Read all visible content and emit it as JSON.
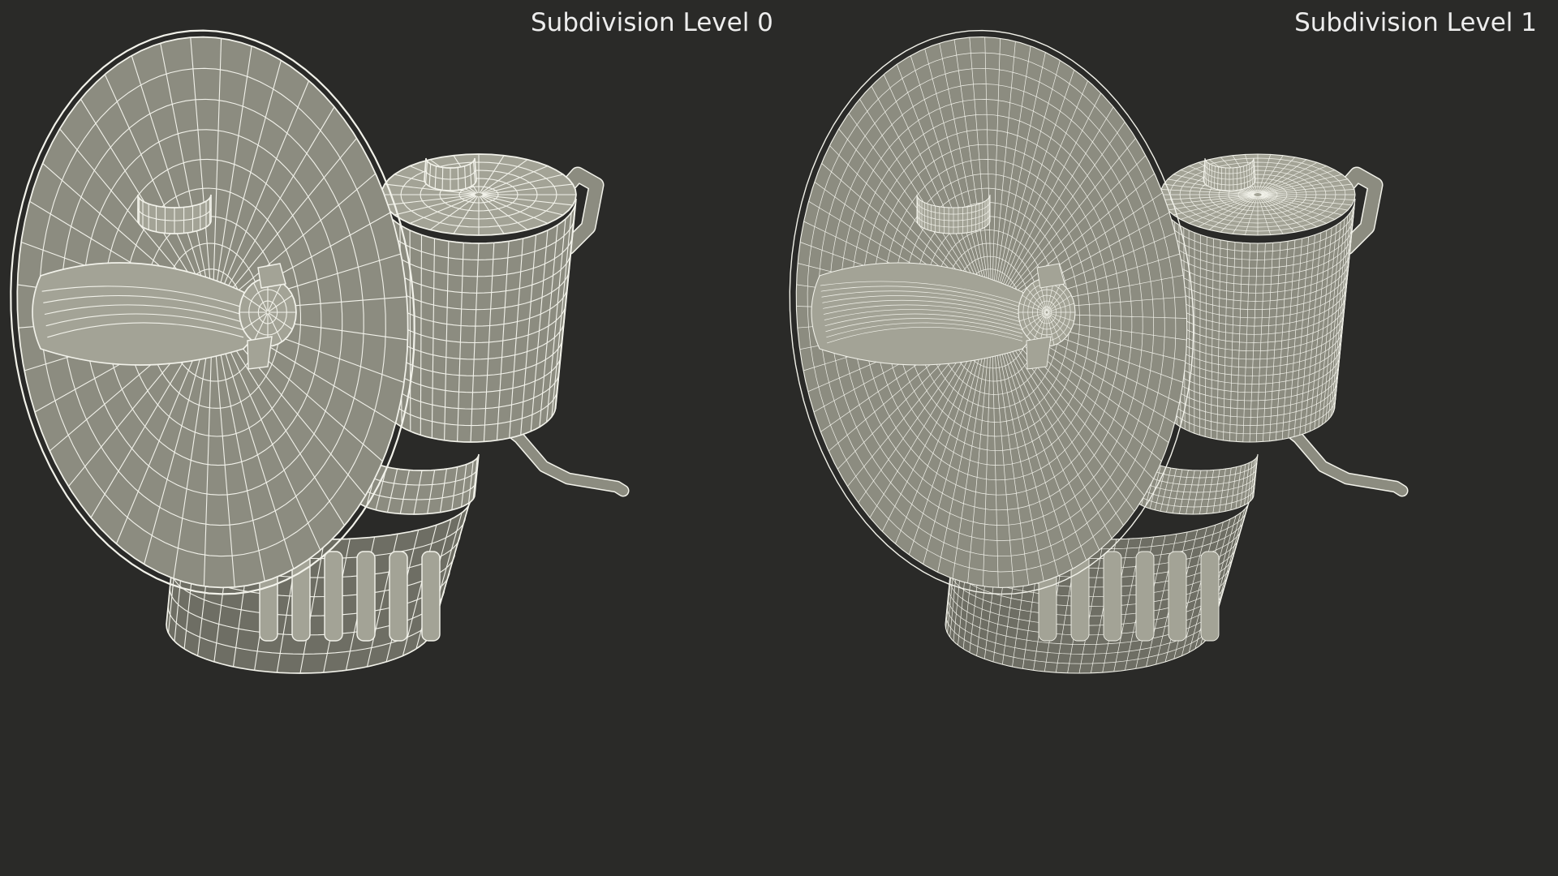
{
  "background": "#2a2a28",
  "mesh_fill": "#8c8c80",
  "mesh_fill_light": "#a3a396",
  "mesh_fill_dark": "#6e6e64",
  "wire_color": "#f2f2ea",
  "captions": {
    "left": "Subdivision Level 0",
    "right": "Subdivision Level 1"
  },
  "models": [
    {
      "name": "carbide-lamp-level-0",
      "subdivision_level": 0
    },
    {
      "name": "carbide-lamp-level-1",
      "subdivision_level": 1
    }
  ]
}
